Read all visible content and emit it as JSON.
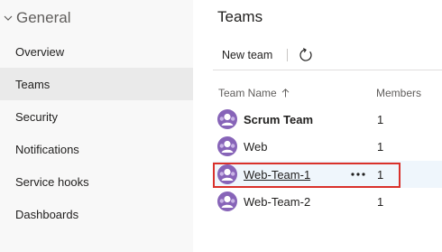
{
  "sidebar": {
    "group_title": "General",
    "items": [
      {
        "label": "Overview"
      },
      {
        "label": "Teams"
      },
      {
        "label": "Security"
      },
      {
        "label": "Notifications"
      },
      {
        "label": "Service hooks"
      },
      {
        "label": "Dashboards"
      }
    ],
    "selected_index": 1
  },
  "main": {
    "title": "Teams",
    "toolbar": {
      "new_team_label": "New team",
      "refresh_icon": "refresh-icon"
    },
    "columns": {
      "name": "Team Name",
      "members": "Members"
    },
    "rows": [
      {
        "name": "Scrum Team",
        "members": "1"
      },
      {
        "name": "Web",
        "members": "1"
      },
      {
        "name": "Web-Team-1",
        "members": "1"
      },
      {
        "name": "Web-Team-2",
        "members": "1"
      }
    ],
    "selected_row_index": 2
  },
  "colors": {
    "accent_highlight": "#d9312b",
    "avatar_purple": "#8764b8",
    "selected_sidebar": "#eaeaea",
    "selected_row": "#eff6fc"
  }
}
